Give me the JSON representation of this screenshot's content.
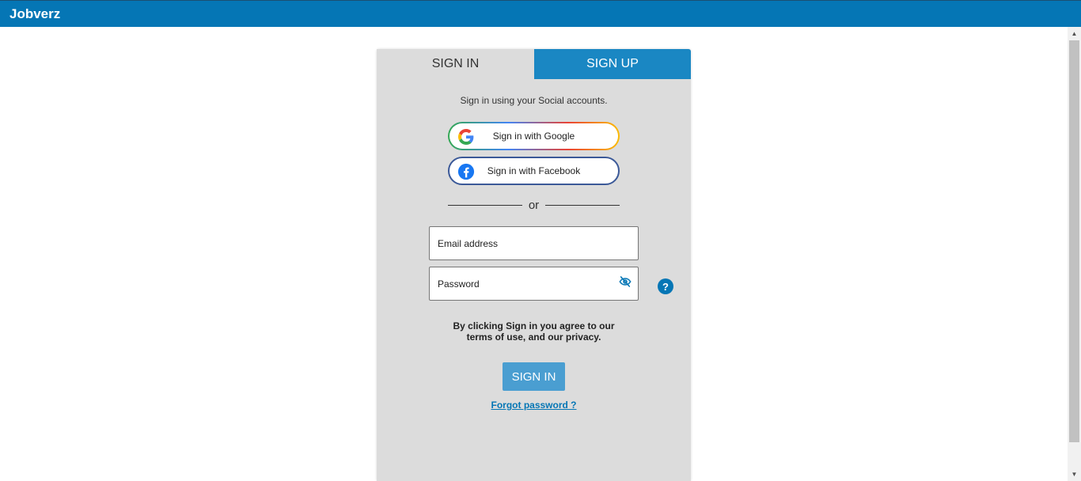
{
  "header": {
    "brand": "Jobverz"
  },
  "tabs": [
    {
      "label": "SIGN IN",
      "active": true
    },
    {
      "label": "SIGN UP",
      "active": false
    }
  ],
  "social": {
    "caption": "Sign in using your Social accounts.",
    "google_label": "Sign in with Google",
    "facebook_label": "Sign in with Facebook"
  },
  "divider": {
    "text": "or"
  },
  "form": {
    "email_placeholder": "Email address",
    "email_value": "",
    "password_placeholder": "Password",
    "password_value": "",
    "help_label": "?"
  },
  "agreement": {
    "line1": "By clicking Sign in you agree to our",
    "line2": "terms of use, and our privacy."
  },
  "signin_button": "SIGN IN",
  "forgot_link": "Forgot password ?",
  "colors": {
    "header": "#0576b5",
    "signup_tab": "#1a87c3",
    "panel": "#dcdcdc",
    "signin_button": "#4a9ed1",
    "link": "#0576b5",
    "facebook": "#3b5998"
  }
}
